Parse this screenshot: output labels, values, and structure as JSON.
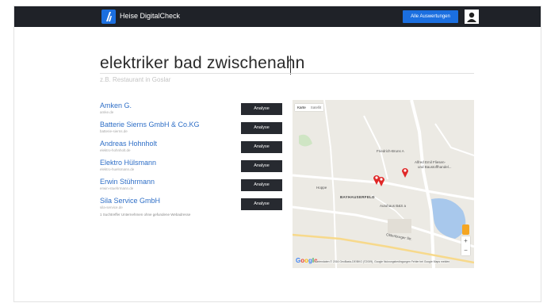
{
  "header": {
    "brand": "Heise DigitalCheck",
    "all_button": "Alle Auswertungen"
  },
  "search": {
    "query": "elektriker bad zwischenahn",
    "placeholder": "z.B. Restaurant in Goslar"
  },
  "results": [
    {
      "name": "Amken G.",
      "domain": "amke.de",
      "button": "Analyse"
    },
    {
      "name": "Batterie Sierns GmbH & Co.KG",
      "domain": "batterie-sierns.de",
      "button": "Analyse"
    },
    {
      "name": "Andreas Hohnholt",
      "domain": "elektro-hohnholt.de",
      "button": "Analyse"
    },
    {
      "name": "Elektro Hülsmann",
      "domain": "elektro-huelsmann.de",
      "button": "Analyse"
    },
    {
      "name": "Erwin Stührmann",
      "domain": "erwin-stuehrmann.de",
      "button": "Analyse"
    },
    {
      "name": "Sila Service GmbH",
      "domain": "sila-service.de",
      "button": "Analyse"
    }
  ],
  "note": "1 Suchtreffer Unternehmen ohne gefundene Webadresse",
  "map": {
    "type_map": "Karte",
    "type_satellite": "Satellit",
    "labels": {
      "friedrich": "Friedrich-Bruns A",
      "fliesen": "Alfred Emil Fliesen-",
      "fliesen2": "und Baustoffhandel...",
      "hoppe": "Hoppe",
      "bayhauserfeld": "BAYHAUSERFELD",
      "autohaus": "Autohaus B&S a",
      "oldenburg": "Oldenburger Str."
    },
    "zoom_in": "+",
    "zoom_out": "−",
    "google": "Google",
    "attribution": "Kartendaten © 2016 GeoBasis-DE/BKG (©2009), Google   Nutzungsbedingungen   Fehler bei Google Maps melden"
  }
}
